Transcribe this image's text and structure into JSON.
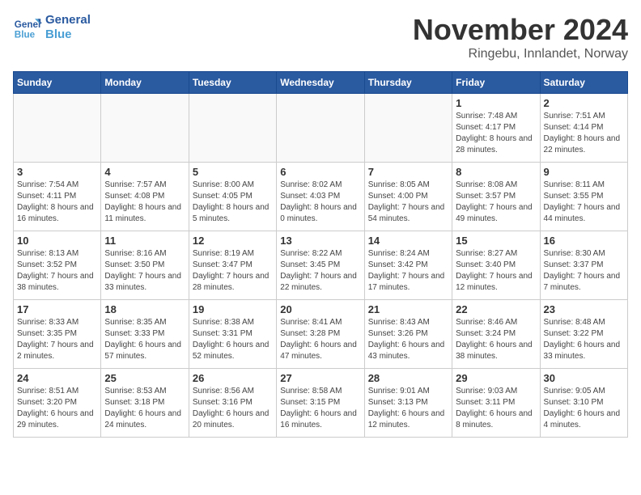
{
  "header": {
    "logo_line1": "General",
    "logo_line2": "Blue",
    "title": "November 2024",
    "subtitle": "Ringebu, Innlandet, Norway"
  },
  "columns": [
    "Sunday",
    "Monday",
    "Tuesday",
    "Wednesday",
    "Thursday",
    "Friday",
    "Saturday"
  ],
  "weeks": [
    [
      {
        "day": "",
        "info": ""
      },
      {
        "day": "",
        "info": ""
      },
      {
        "day": "",
        "info": ""
      },
      {
        "day": "",
        "info": ""
      },
      {
        "day": "",
        "info": ""
      },
      {
        "day": "1",
        "info": "Sunrise: 7:48 AM\nSunset: 4:17 PM\nDaylight: 8 hours and 28 minutes."
      },
      {
        "day": "2",
        "info": "Sunrise: 7:51 AM\nSunset: 4:14 PM\nDaylight: 8 hours and 22 minutes."
      }
    ],
    [
      {
        "day": "3",
        "info": "Sunrise: 7:54 AM\nSunset: 4:11 PM\nDaylight: 8 hours and 16 minutes."
      },
      {
        "day": "4",
        "info": "Sunrise: 7:57 AM\nSunset: 4:08 PM\nDaylight: 8 hours and 11 minutes."
      },
      {
        "day": "5",
        "info": "Sunrise: 8:00 AM\nSunset: 4:05 PM\nDaylight: 8 hours and 5 minutes."
      },
      {
        "day": "6",
        "info": "Sunrise: 8:02 AM\nSunset: 4:03 PM\nDaylight: 8 hours and 0 minutes."
      },
      {
        "day": "7",
        "info": "Sunrise: 8:05 AM\nSunset: 4:00 PM\nDaylight: 7 hours and 54 minutes."
      },
      {
        "day": "8",
        "info": "Sunrise: 8:08 AM\nSunset: 3:57 PM\nDaylight: 7 hours and 49 minutes."
      },
      {
        "day": "9",
        "info": "Sunrise: 8:11 AM\nSunset: 3:55 PM\nDaylight: 7 hours and 44 minutes."
      }
    ],
    [
      {
        "day": "10",
        "info": "Sunrise: 8:13 AM\nSunset: 3:52 PM\nDaylight: 7 hours and 38 minutes."
      },
      {
        "day": "11",
        "info": "Sunrise: 8:16 AM\nSunset: 3:50 PM\nDaylight: 7 hours and 33 minutes."
      },
      {
        "day": "12",
        "info": "Sunrise: 8:19 AM\nSunset: 3:47 PM\nDaylight: 7 hours and 28 minutes."
      },
      {
        "day": "13",
        "info": "Sunrise: 8:22 AM\nSunset: 3:45 PM\nDaylight: 7 hours and 22 minutes."
      },
      {
        "day": "14",
        "info": "Sunrise: 8:24 AM\nSunset: 3:42 PM\nDaylight: 7 hours and 17 minutes."
      },
      {
        "day": "15",
        "info": "Sunrise: 8:27 AM\nSunset: 3:40 PM\nDaylight: 7 hours and 12 minutes."
      },
      {
        "day": "16",
        "info": "Sunrise: 8:30 AM\nSunset: 3:37 PM\nDaylight: 7 hours and 7 minutes."
      }
    ],
    [
      {
        "day": "17",
        "info": "Sunrise: 8:33 AM\nSunset: 3:35 PM\nDaylight: 7 hours and 2 minutes."
      },
      {
        "day": "18",
        "info": "Sunrise: 8:35 AM\nSunset: 3:33 PM\nDaylight: 6 hours and 57 minutes."
      },
      {
        "day": "19",
        "info": "Sunrise: 8:38 AM\nSunset: 3:31 PM\nDaylight: 6 hours and 52 minutes."
      },
      {
        "day": "20",
        "info": "Sunrise: 8:41 AM\nSunset: 3:28 PM\nDaylight: 6 hours and 47 minutes."
      },
      {
        "day": "21",
        "info": "Sunrise: 8:43 AM\nSunset: 3:26 PM\nDaylight: 6 hours and 43 minutes."
      },
      {
        "day": "22",
        "info": "Sunrise: 8:46 AM\nSunset: 3:24 PM\nDaylight: 6 hours and 38 minutes."
      },
      {
        "day": "23",
        "info": "Sunrise: 8:48 AM\nSunset: 3:22 PM\nDaylight: 6 hours and 33 minutes."
      }
    ],
    [
      {
        "day": "24",
        "info": "Sunrise: 8:51 AM\nSunset: 3:20 PM\nDaylight: 6 hours and 29 minutes."
      },
      {
        "day": "25",
        "info": "Sunrise: 8:53 AM\nSunset: 3:18 PM\nDaylight: 6 hours and 24 minutes."
      },
      {
        "day": "26",
        "info": "Sunrise: 8:56 AM\nSunset: 3:16 PM\nDaylight: 6 hours and 20 minutes."
      },
      {
        "day": "27",
        "info": "Sunrise: 8:58 AM\nSunset: 3:15 PM\nDaylight: 6 hours and 16 minutes."
      },
      {
        "day": "28",
        "info": "Sunrise: 9:01 AM\nSunset: 3:13 PM\nDaylight: 6 hours and 12 minutes."
      },
      {
        "day": "29",
        "info": "Sunrise: 9:03 AM\nSunset: 3:11 PM\nDaylight: 6 hours and 8 minutes."
      },
      {
        "day": "30",
        "info": "Sunrise: 9:05 AM\nSunset: 3:10 PM\nDaylight: 6 hours and 4 minutes."
      }
    ]
  ]
}
